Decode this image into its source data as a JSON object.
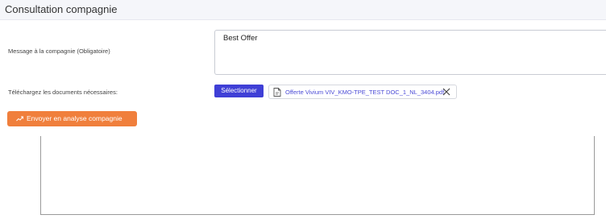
{
  "header": {
    "title": "Consultation compagnie"
  },
  "form": {
    "message_label": "Message à la compagnie (Obligatoire)",
    "message_value": "Best Offer",
    "documents_label": "Téléchargez les documents nécessaires:",
    "select_button_label": "Sélectionner",
    "attached_file": {
      "name": "Offerte Vivium VIV_KMO-TPE_TEST DOC_1_NL_3404.pdf",
      "icon": "file-pdf-icon"
    },
    "send_button_label": "Envoyer en analyse compagnie",
    "send_icon": "send-trend-icon"
  },
  "colors": {
    "primary": "#3f3fd6",
    "accent": "#f07f3c",
    "link": "#4b4bd6",
    "header_bg": "#f5f6fa"
  }
}
